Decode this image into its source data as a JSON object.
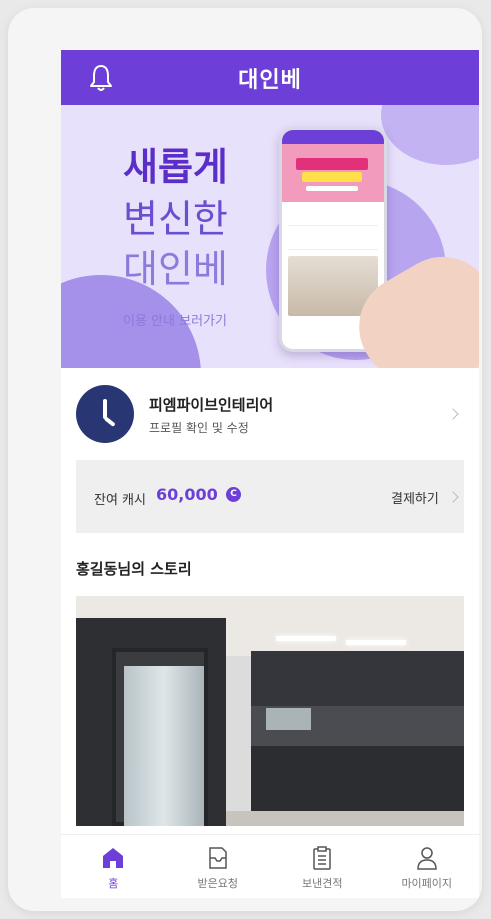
{
  "header": {
    "title": "대인베",
    "bell_icon": "bell-icon"
  },
  "banner": {
    "headline": "새롭게",
    "sub1": "변신한",
    "sub2": "대인베",
    "link": "이용 안내 보러가기"
  },
  "profile": {
    "name": "피엠파이브인테리어",
    "edit_label": "프로필 확인 및 수정",
    "avatar_icon": "clock-icon"
  },
  "cash": {
    "label": "잔여 캐시",
    "amount": "60,000",
    "coin": "C",
    "pay_label": "결제하기"
  },
  "story": {
    "title": "홍길동님의 스토리"
  },
  "tabs": [
    {
      "label": "홈",
      "icon": "home-icon",
      "active": true
    },
    {
      "label": "받은요청",
      "icon": "inbox-icon",
      "active": false
    },
    {
      "label": "보낸견적",
      "icon": "clipboard-icon",
      "active": false
    },
    {
      "label": "마이페이지",
      "icon": "person-icon",
      "active": false
    }
  ],
  "colors": {
    "brand": "#6d3fd8",
    "banner_bg": "#e8e1fb",
    "avatar_bg": "#283673"
  }
}
